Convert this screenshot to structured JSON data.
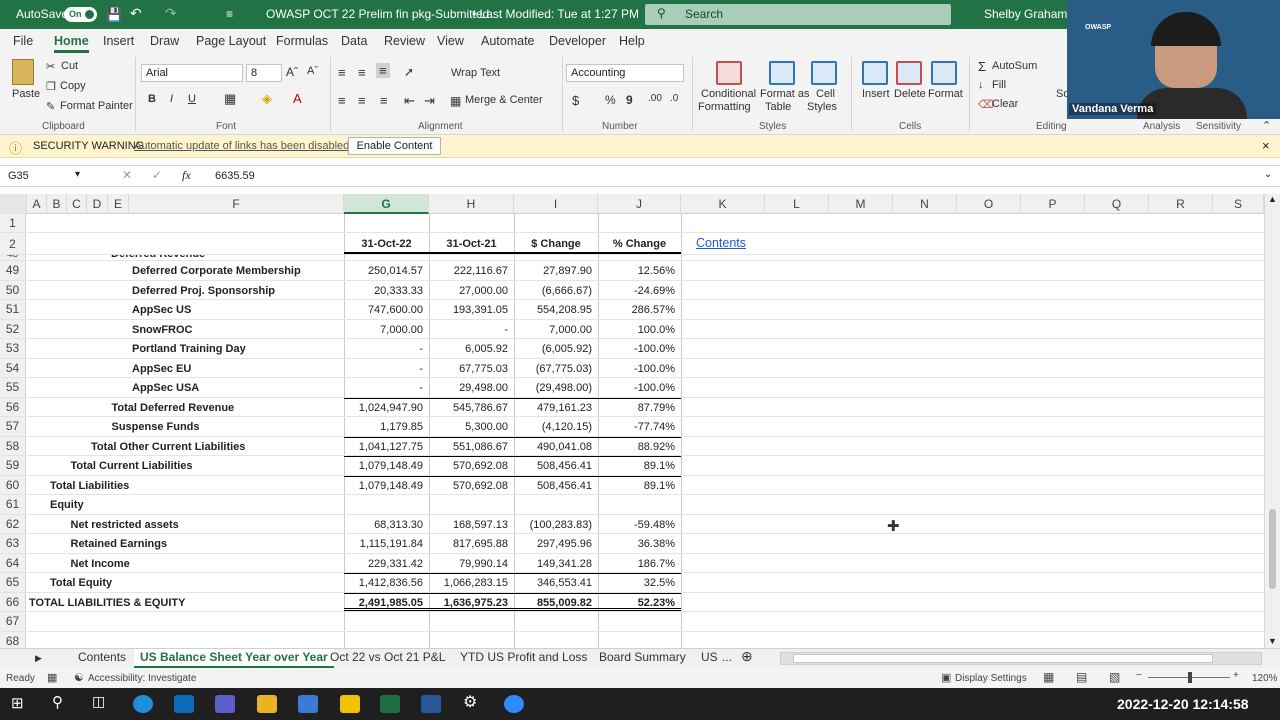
{
  "titlebar": {
    "autosave": "AutoSave",
    "autosave_state": "On",
    "filename": "OWASP OCT 22 Prelim fin pkg-Submitted",
    "modified": "• Last Modified: Tue at 1:27 PM",
    "search_placeholder": "Search",
    "user": "Shelby Graham"
  },
  "menu": [
    "File",
    "Home",
    "Insert",
    "Draw",
    "Page Layout",
    "Formulas",
    "Data",
    "Review",
    "View",
    "Automate",
    "Developer",
    "Help"
  ],
  "ribbon": {
    "paste": "Paste",
    "cut": "Cut",
    "copy": "Copy",
    "format_painter": "Format Painter",
    "clipboard": "Clipboard",
    "font_name": "Arial",
    "font_size": "8",
    "font": "Font",
    "wrap_text": "Wrap Text",
    "merge_center": "Merge & Center",
    "alignment": "Alignment",
    "number_format": "Accounting",
    "number": "Number",
    "conditional": "Conditional",
    "formatting": "Formatting",
    "format_as": "Format as",
    "table": "Table",
    "cell": "Cell",
    "styles_btn": "Styles",
    "styles": "Styles",
    "insert": "Insert",
    "delete": "Delete",
    "format": "Format",
    "cells": "Cells",
    "autosum": "AutoSum",
    "fill": "Fill",
    "clear": "Clear",
    "editing": "Editing",
    "so": "So",
    "fi": "Fil",
    "analysis": "Analysis",
    "sensitivity": "Sensitivity"
  },
  "warning": {
    "title": "SECURITY WARNING",
    "message": "Automatic update of links has been disabled",
    "button": "Enable Content"
  },
  "formula": {
    "cellref": "G35",
    "value": "6635.59"
  },
  "columns": [
    "A",
    "B",
    "C",
    "D",
    "E",
    "F",
    "G",
    "H",
    "I",
    "J",
    "K",
    "L",
    "M",
    "N",
    "O",
    "P",
    "Q",
    "R",
    "S"
  ],
  "header": {
    "g": "31-Oct-22",
    "h": "31-Oct-21",
    "i": "$ Change",
    "j": "% Change",
    "k": "Contents",
    "partial": "Deferred Revenue"
  },
  "rows": [
    {
      "n": "49",
      "label": "Deferred Corporate Membership",
      "indent": 4,
      "g": "250,014.57",
      "h": "222,116.67",
      "i": "27,897.90",
      "j": "12.56%"
    },
    {
      "n": "50",
      "label": "Deferred Proj. Sponsorship",
      "indent": 4,
      "g": "20,333.33",
      "h": "27,000.00",
      "i": "(6,666.67)",
      "j": "-24.69%"
    },
    {
      "n": "51",
      "label": "AppSec US",
      "indent": 4,
      "g": "747,600.00",
      "h": "193,391.05",
      "i": "554,208.95",
      "j": "286.57%"
    },
    {
      "n": "52",
      "label": "SnowFROC",
      "indent": 4,
      "g": "7,000.00",
      "h": "-",
      "i": "7,000.00",
      "j": "100.0%"
    },
    {
      "n": "53",
      "label": "Portland Training Day",
      "indent": 4,
      "g": "-",
      "h": "6,005.92",
      "i": "(6,005.92)",
      "j": "-100.0%"
    },
    {
      "n": "54",
      "label": "AppSec EU",
      "indent": 4,
      "g": "-",
      "h": "67,775.03",
      "i": "(67,775.03)",
      "j": "-100.0%"
    },
    {
      "n": "55",
      "label": "AppSec USA",
      "indent": 4,
      "g": "-",
      "h": "29,498.00",
      "i": "(29,498.00)",
      "j": "-100.0%"
    },
    {
      "n": "56",
      "label": "Total Deferred Revenue",
      "indent": 3,
      "g": "1,024,947.90",
      "h": "545,786.67",
      "i": "479,161.23",
      "j": "87.79%"
    },
    {
      "n": "57",
      "label": "Suspense Funds",
      "indent": 3,
      "g": "1,179.85",
      "h": "5,300.00",
      "i": "(4,120.15)",
      "j": "-77.74%"
    },
    {
      "n": "58",
      "label": "Total Other Current Liabilities",
      "indent": 2,
      "g": "1,041,127.75",
      "h": "551,086.67",
      "i": "490,041.08",
      "j": "88.92%"
    },
    {
      "n": "59",
      "label": "Total Current Liabilities",
      "indent": 1,
      "g": "1,079,148.49",
      "h": "570,692.08",
      "i": "508,456.41",
      "j": "89.1%"
    },
    {
      "n": "60",
      "label": "Total Liabilities",
      "indent": 0,
      "g": "1,079,148.49",
      "h": "570,692.08",
      "i": "508,456.41",
      "j": "89.1%"
    },
    {
      "n": "61",
      "label": "Equity",
      "indent": 0,
      "g": "",
      "h": "",
      "i": "",
      "j": ""
    },
    {
      "n": "62",
      "label": "Net restricted assets",
      "indent": 1,
      "g": "68,313.30",
      "h": "168,597.13",
      "i": "(100,283.83)",
      "j": "-59.48%"
    },
    {
      "n": "63",
      "label": "Retained Earnings",
      "indent": 1,
      "g": "1,115,191.84",
      "h": "817,695.88",
      "i": "297,495.96",
      "j": "36.38%"
    },
    {
      "n": "64",
      "label": "Net Income",
      "indent": 1,
      "g": "229,331.42",
      "h": "79,990.14",
      "i": "149,341.28",
      "j": "186.7%"
    },
    {
      "n": "65",
      "label": "Total Equity",
      "indent": 0,
      "g": "1,412,836.56",
      "h": "1,066,283.15",
      "i": "346,553.41",
      "j": "32.5%"
    },
    {
      "n": "66",
      "label": "TOTAL LIABILITIES & EQUITY",
      "indent": -1,
      "g": "2,491,985.05",
      "h": "1,636,975.23",
      "i": "855,009.82",
      "j": "52.23%"
    },
    {
      "n": "67",
      "label": "",
      "indent": 0,
      "g": "",
      "h": "",
      "i": "",
      "j": ""
    },
    {
      "n": "68",
      "label": "",
      "indent": 0,
      "g": "",
      "h": "",
      "i": "",
      "j": ""
    }
  ],
  "tabs": [
    "Contents",
    "US Balance Sheet Year over Year",
    "Oct 22 vs Oct 21 P&L",
    "YTD US Profit and Loss",
    "Board Summary",
    "US"
  ],
  "tabs_more": "...",
  "status": {
    "ready": "Ready",
    "accessibility": "Accessibility: Investigate",
    "display": "Display Settings",
    "zoom": "120%"
  },
  "video": {
    "name": "Vandana Verma",
    "logo": "OWASP"
  },
  "taskbar": {
    "datetime": "2022-12-20  12:14:58"
  }
}
